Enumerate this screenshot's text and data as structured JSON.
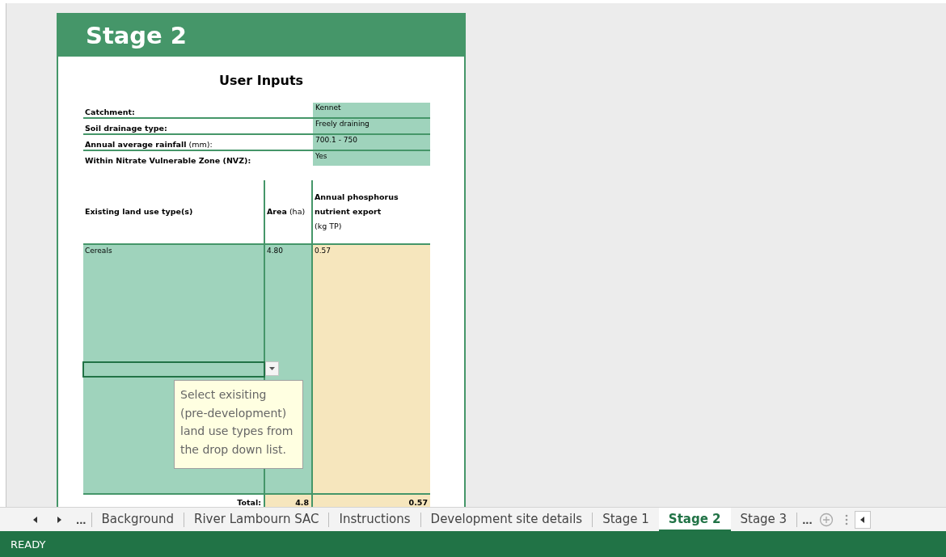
{
  "sheet_title": "Stage 2",
  "section_title": "User Inputs",
  "inputs": [
    {
      "label": "Catchment:",
      "value": "Kennet"
    },
    {
      "label": "Soil drainage type:",
      "value": "Freely draining"
    },
    {
      "label": "Annual average rainfall",
      "unit": "(mm):",
      "value": "700.1 - 750"
    },
    {
      "label": "Within Nitrate Vulnerable Zone (NVZ):",
      "value": "Yes"
    }
  ],
  "columns": [
    {
      "title": "Existing land use type(s)"
    },
    {
      "title": "Area",
      "unit": "(ha)"
    },
    {
      "title": "Annual phosphorus nutrient export",
      "unit": "(kg TP)"
    }
  ],
  "rows": [
    {
      "land_use": "Cereals",
      "area": "4.80",
      "export": "0.57"
    }
  ],
  "total": {
    "label": "Total:",
    "area": "4.8",
    "export": "0.57"
  },
  "tooltip": "Select exisiting (pre-development) land use types from the drop down list.",
  "tab_bar": {
    "more_left": "...",
    "more_right": "...",
    "tabs": [
      {
        "label": "Background",
        "selected": false
      },
      {
        "label": "River Lambourn SAC",
        "selected": false
      },
      {
        "label": "Instructions",
        "selected": false
      },
      {
        "label": "Development site details",
        "selected": false
      },
      {
        "label": "Stage 1",
        "selected": false
      },
      {
        "label": "Stage 2",
        "selected": true
      },
      {
        "label": "Stage 3",
        "selected": false
      }
    ]
  },
  "status": "READY"
}
